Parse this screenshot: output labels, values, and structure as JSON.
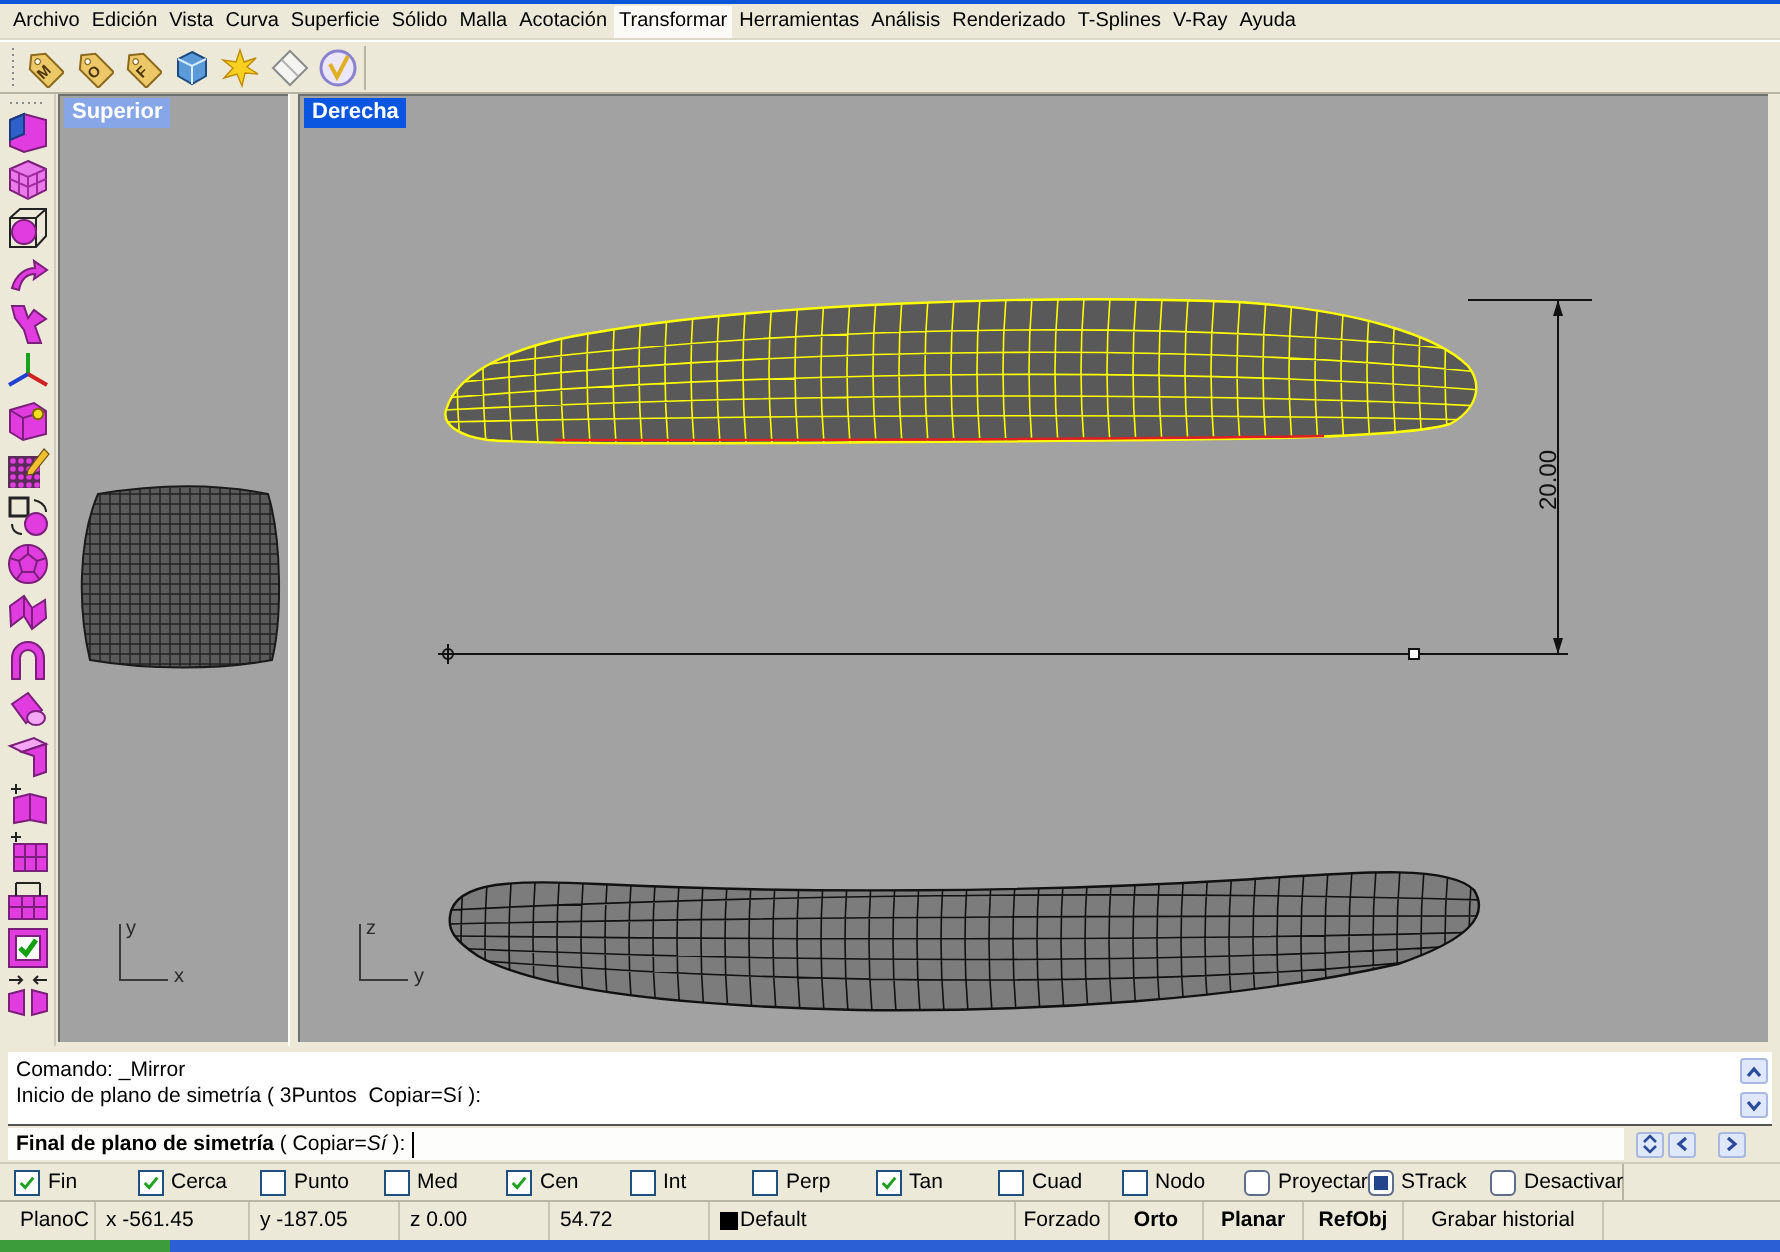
{
  "menus": [
    {
      "label": "Archivo",
      "selected": false
    },
    {
      "label": "Edición",
      "selected": false
    },
    {
      "label": "Vista",
      "selected": false
    },
    {
      "label": "Curva",
      "selected": false
    },
    {
      "label": "Superficie",
      "selected": false
    },
    {
      "label": "Sólido",
      "selected": false
    },
    {
      "label": "Malla",
      "selected": false
    },
    {
      "label": "Acotación",
      "selected": false
    },
    {
      "label": "Transformar",
      "selected": true
    },
    {
      "label": "Herramientas",
      "selected": false
    },
    {
      "label": "Análisis",
      "selected": false
    },
    {
      "label": "Renderizado",
      "selected": false
    },
    {
      "label": "T-Splines",
      "selected": false
    },
    {
      "label": "V-Ray",
      "selected": false
    },
    {
      "label": "Ayuda",
      "selected": false
    }
  ],
  "toolbar": [
    {
      "kind": "tag",
      "letter": "M"
    },
    {
      "kind": "tag",
      "letter": "O"
    },
    {
      "kind": "tag",
      "letter": "F"
    },
    {
      "kind": "cube"
    },
    {
      "kind": "star"
    },
    {
      "kind": "diamond"
    },
    {
      "kind": "check-circle"
    }
  ],
  "viewports": [
    {
      "title": "Superior",
      "active": false,
      "axes": [
        "y",
        "x"
      ]
    },
    {
      "title": "Derecha",
      "active": true,
      "axes": [
        "z",
        "y"
      ],
      "objects": [
        {
          "selected": true
        },
        {
          "selected": false
        }
      ],
      "dimension": "20.00"
    }
  ],
  "command_history": [
    "Comando: _Mirror",
    "Inicio de plano de simetría ( 3Puntos  Copiar=Sí ):"
  ],
  "prompt": "**Final de plano de simetría** ( Copiar=*Sí* ):",
  "osnaps": [
    {
      "label": "Fin",
      "kind": "check",
      "checked": true
    },
    {
      "label": "Cerca",
      "kind": "check",
      "checked": true
    },
    {
      "label": "Punto",
      "kind": "check",
      "checked": false
    },
    {
      "label": "Med",
      "kind": "check",
      "checked": false
    },
    {
      "label": "Cen",
      "kind": "check",
      "checked": true
    },
    {
      "label": "Int",
      "kind": "check",
      "checked": false
    },
    {
      "label": "Perp",
      "kind": "check",
      "checked": false
    },
    {
      "label": "Tan",
      "kind": "check",
      "checked": true
    },
    {
      "label": "Cuad",
      "kind": "check",
      "checked": false
    },
    {
      "label": "Nodo",
      "kind": "check",
      "checked": false
    },
    {
      "label": "Proyectar",
      "kind": "toggle",
      "checked": false
    },
    {
      "label": "STrack",
      "kind": "toggle",
      "checked": true
    },
    {
      "label": "Desactivar",
      "kind": "toggle",
      "checked": false
    }
  ],
  "status_bar": {
    "cplane": "PlanoC",
    "x": "x -561.45",
    "y": "y -187.05",
    "z": "z 0.00",
    "distance": "54.72",
    "layer": {
      "name": "Default",
      "color": "#000000"
    },
    "toggles": [
      {
        "label": "Forzado",
        "on": false
      },
      {
        "label": "Orto",
        "on": true
      },
      {
        "label": "Planar",
        "on": true
      },
      {
        "label": "RefObj",
        "on": true
      },
      {
        "label": "Grabar historial",
        "on": false
      }
    ]
  }
}
